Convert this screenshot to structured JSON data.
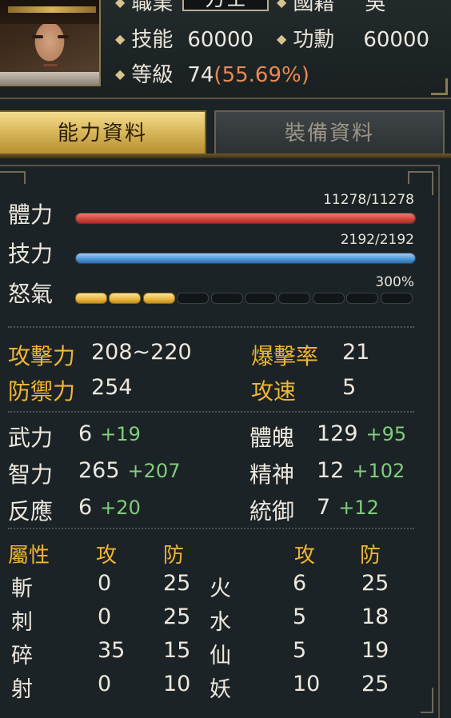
{
  "header": {
    "job_label": "職業",
    "job_value": "方士",
    "nation_label": "國籍",
    "nation_value": "吳",
    "skill_label": "技能",
    "skill_value": "60000",
    "merit_label": "功勳",
    "merit_value": "60000",
    "level_label": "等級",
    "level_value": "74",
    "level_pct": "(55.69%)"
  },
  "tabs": {
    "ability": "能力資料",
    "equipment": "裝備資料"
  },
  "bars": {
    "hp": {
      "label": "體力",
      "value": "11278/11278",
      "fraction": 1.0
    },
    "mp": {
      "label": "技力",
      "value": "2192/2192",
      "fraction": 1.0
    },
    "rage": {
      "label": "怒氣",
      "value": "300%",
      "segments_total": 10,
      "segments_filled": 3
    }
  },
  "combat": {
    "attack_label": "攻擊力",
    "attack_value": "208~220",
    "crit_label": "爆擊率",
    "crit_value": "21",
    "defense_label": "防禦力",
    "defense_value": "254",
    "speed_label": "攻速",
    "speed_value": "5"
  },
  "attributes": {
    "str_label": "武力",
    "str_value": "6",
    "str_bonus": "+19",
    "vit_label": "體魄",
    "vit_value": "129",
    "vit_bonus": "+95",
    "int_label": "智力",
    "int_value": "265",
    "int_bonus": "+207",
    "spi_label": "精神",
    "spi_value": "12",
    "spi_bonus": "+102",
    "agi_label": "反應",
    "agi_value": "6",
    "agi_bonus": "+20",
    "cmd_label": "統御",
    "cmd_value": "7",
    "cmd_bonus": "+12"
  },
  "elements": {
    "header_attr": "屬性",
    "header_atk": "攻",
    "header_def": "防",
    "rows": [
      {
        "left_name": "斬",
        "left_atk": "0",
        "left_def": "25",
        "right_name": "火",
        "right_atk": "6",
        "right_def": "25"
      },
      {
        "left_name": "刺",
        "left_atk": "0",
        "left_def": "25",
        "right_name": "水",
        "right_atk": "5",
        "right_def": "18"
      },
      {
        "left_name": "碎",
        "left_atk": "35",
        "left_def": "15",
        "right_name": "仙",
        "right_atk": "5",
        "right_def": "19"
      },
      {
        "left_name": "射",
        "left_atk": "0",
        "left_def": "10",
        "right_name": "妖",
        "right_atk": "10",
        "right_def": "25"
      }
    ]
  },
  "colors": {
    "gold_label": "#f0b533",
    "bonus_green": "#7fcf7c",
    "hp_red": "#d2443a",
    "mp_blue": "#4b95d6",
    "rage_yellow": "#e9b640",
    "level_pct_orange": "#e98a52"
  }
}
